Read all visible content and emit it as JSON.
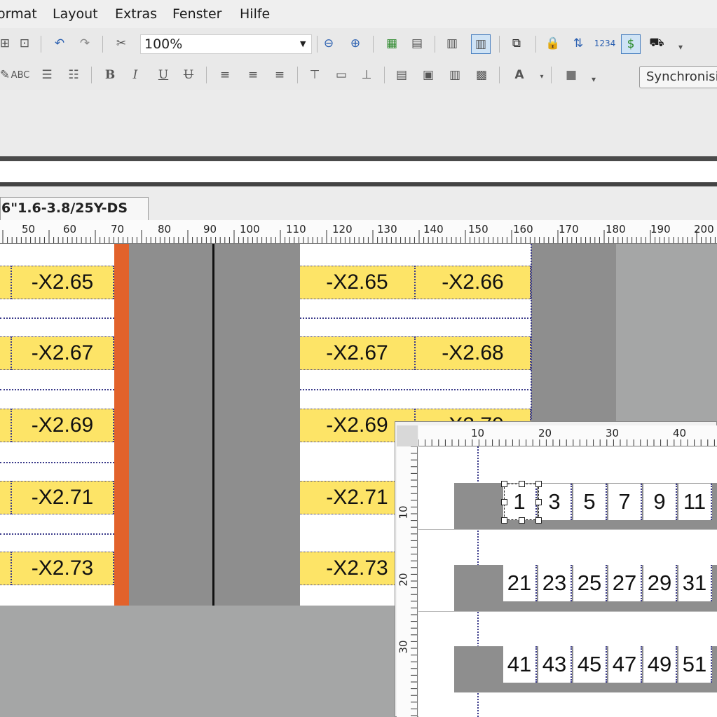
{
  "menu": {
    "items": [
      "ormat",
      "Layout",
      "Extras",
      "Fenster",
      "Hilfe"
    ]
  },
  "toolbar": {
    "zoom_value": "100%",
    "tooltip": "Synchronisieren"
  },
  "document_tab": {
    "label": "6\"1.6-3.8/25Y-DS"
  },
  "ruler": {
    "labels": [
      "50",
      "60",
      "70",
      "80",
      "90",
      "100",
      "110",
      "120",
      "130",
      "140",
      "150",
      "160",
      "170",
      "180",
      "190",
      "200"
    ]
  },
  "left_column": {
    "labels": [
      "-X2.65",
      "-X2.67",
      "-X2.69",
      "-X2.71",
      "-X2.73"
    ]
  },
  "right_column": {
    "rows": [
      [
        "-X2.65",
        "-X2.66"
      ],
      [
        "-X2.67",
        "-X2.68"
      ],
      [
        "-X2.69",
        "-X2.70"
      ],
      [
        "-X2.71",
        ""
      ],
      [
        "-X2.73",
        ""
      ]
    ]
  },
  "inset": {
    "ruler_top": [
      "10",
      "20",
      "30",
      "40"
    ],
    "ruler_left": [
      "10",
      "20",
      "30"
    ],
    "rows": [
      [
        "1",
        "3",
        "5",
        "7",
        "9",
        "11"
      ],
      [
        "21",
        "23",
        "25",
        "27",
        "29",
        "31"
      ],
      [
        "41",
        "43",
        "45",
        "47",
        "49",
        "51"
      ]
    ]
  },
  "colors": {
    "label_yellow": "#fde467",
    "accent_orange": "#e2622b",
    "canvas_gray": "#8e8e8e"
  }
}
